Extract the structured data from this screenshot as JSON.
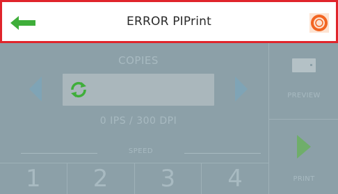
{
  "header": {
    "title": "ERROR PIPrint",
    "back_icon": "arrow-left-icon",
    "help_icon": "lifebuoy-icon"
  },
  "colors": {
    "error_border": "#e0242b",
    "back_arrow": "#3fae3a",
    "help_icon": "#f26522",
    "overlay": "#8ca0a8",
    "spinner": "#3fae3a"
  },
  "copies": {
    "label": "COPIES",
    "value": ""
  },
  "info": {
    "text": "0 IPS  /  300 DPI"
  },
  "speed": {
    "label": "SPEED",
    "buttons": [
      "1",
      "2",
      "3",
      "4"
    ]
  },
  "sidebar": {
    "preview_label": "PREVIEW",
    "print_label": "PRINT"
  }
}
